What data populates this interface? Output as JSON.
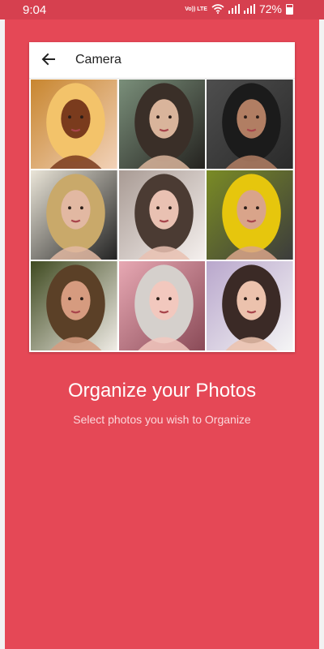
{
  "status_bar": {
    "time": "9:04",
    "network_badge": "Vo)) LTE",
    "battery_percent": "72%"
  },
  "toolbar": {
    "title": "Camera",
    "back_icon": "arrow-back-icon"
  },
  "photos": [
    {
      "label": "photo-1",
      "palette": [
        "#c8862f",
        "#f3c36a",
        "#7a3b1d",
        "#f2d2b9"
      ]
    },
    {
      "label": "photo-2",
      "palette": [
        "#7a8f7a",
        "#3a2f28",
        "#d9b49b",
        "#24221f"
      ]
    },
    {
      "label": "photo-3",
      "palette": [
        "#4e4e4e",
        "#1b1b1b",
        "#b17e63",
        "#2a2a2a"
      ]
    },
    {
      "label": "photo-4",
      "palette": [
        "#eae5d8",
        "#c9a96a",
        "#e2b8a2",
        "#222222"
      ]
    },
    {
      "label": "photo-5",
      "palette": [
        "#a99b94",
        "#4b3b33",
        "#e9c1b2",
        "#f5f0ee"
      ]
    },
    {
      "label": "photo-6",
      "palette": [
        "#7a8b25",
        "#e6c60d",
        "#d9a48a",
        "#3c3c3c"
      ]
    },
    {
      "label": "photo-7",
      "palette": [
        "#3f4a20",
        "#5b4027",
        "#d69b7f",
        "#f0ece6"
      ]
    },
    {
      "label": "photo-8",
      "palette": [
        "#e7a8b3",
        "#d5d0cc",
        "#f2c8be",
        "#8a4a57"
      ]
    },
    {
      "label": "photo-9",
      "palette": [
        "#b9a7cc",
        "#3b2a26",
        "#ecc2ad",
        "#f5f5f5"
      ]
    }
  ],
  "main": {
    "headline": "Organize your Photos",
    "subline": "Select photos you wish to Organize"
  },
  "colors": {
    "background": "#e54856",
    "status_bar": "#d6404f",
    "card": "#ffffff"
  }
}
